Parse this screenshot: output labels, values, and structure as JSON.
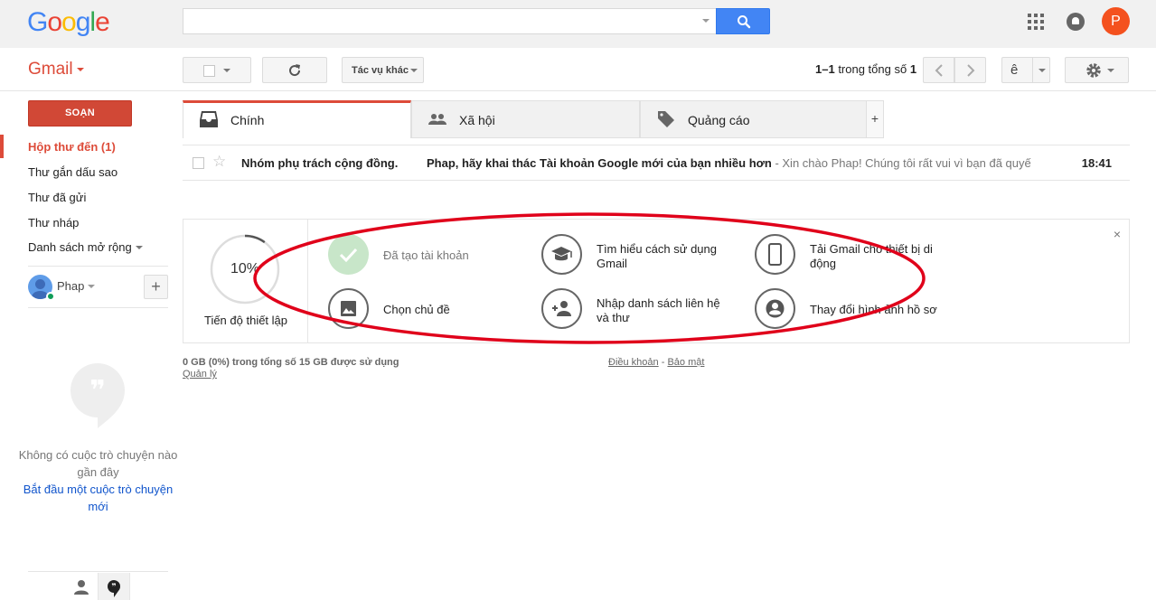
{
  "header": {
    "logo_letters": [
      "G",
      "o",
      "o",
      "g",
      "l",
      "e"
    ],
    "logo_colors": [
      "#4285f4",
      "#ea4335",
      "#fbbc05",
      "#4285f4",
      "#34a853",
      "#ea4335"
    ],
    "search": {
      "value": "",
      "placeholder": ""
    },
    "user_initial": "P",
    "avatar_color": "#f4511e"
  },
  "app": {
    "name": "Gmail",
    "accent": "#dd4b39"
  },
  "toolbar": {
    "more_actions": "Tác vụ khác",
    "range": "1–1",
    "range_of": " trong tổng số ",
    "total": "1",
    "lang_label": "ê"
  },
  "sidebar": {
    "compose": "SOẠN",
    "items": [
      {
        "label": "Hộp thư đến (1)",
        "active": true
      },
      {
        "label": "Thư gắn dấu sao",
        "active": false
      },
      {
        "label": "Thư đã gửi",
        "active": false
      },
      {
        "label": "Thư nháp",
        "active": false
      },
      {
        "label": "Danh sách mở rộng",
        "active": false
      }
    ],
    "user_name": "Phap",
    "add_label": "+",
    "no_chats": "Không có cuộc trò chuyện nào gần đây",
    "start_chat": "Bắt đầu một cuộc trò chuyện mới"
  },
  "tabs": [
    {
      "label": "Chính",
      "icon": "inbox-icon",
      "active": true
    },
    {
      "label": "Xã hội",
      "icon": "people-icon",
      "active": false
    },
    {
      "label": "Quảng cáo",
      "icon": "tag-icon",
      "active": false
    }
  ],
  "tab_add": "+",
  "emails": [
    {
      "sender": "Nhóm phụ trách cộng đồng.",
      "subject": "Phap, hãy khai thác Tài khoản Google mới của bạn nhiều hơn",
      "snippet": " - Xin chào Phap! Chúng tôi rất vui vì bạn đã quyế",
      "time": "18:41"
    }
  ],
  "setup": {
    "progress_percent": 10,
    "progress_text": "10%",
    "progress_label": "Tiến độ thiết lập",
    "tasks": [
      {
        "label": "Đã tạo tài khoản",
        "icon": "check-icon",
        "done": true
      },
      {
        "label": "Tìm hiểu cách sử dụng Gmail",
        "icon": "graduation-cap-icon",
        "done": false
      },
      {
        "label": "Tải Gmail cho thiết bị di động",
        "icon": "mobile-phone-icon",
        "done": false
      },
      {
        "label": "Chọn chủ đề",
        "icon": "image-icon",
        "done": false
      },
      {
        "label": "Nhập danh sách liên hệ và thư",
        "icon": "add-person-icon",
        "done": false
      },
      {
        "label": "Thay đổi hình ảnh hồ sơ",
        "icon": "account-circle-icon",
        "done": false
      }
    ],
    "close": "×"
  },
  "footer": {
    "storage": "0 GB (0%) trong tổng số 15 GB được sử dụng",
    "manage": "Quản lý",
    "terms": "Điều khoản",
    "separator": " - ",
    "privacy": "Bảo mật"
  },
  "annotation": {
    "color": "#e0001a"
  }
}
